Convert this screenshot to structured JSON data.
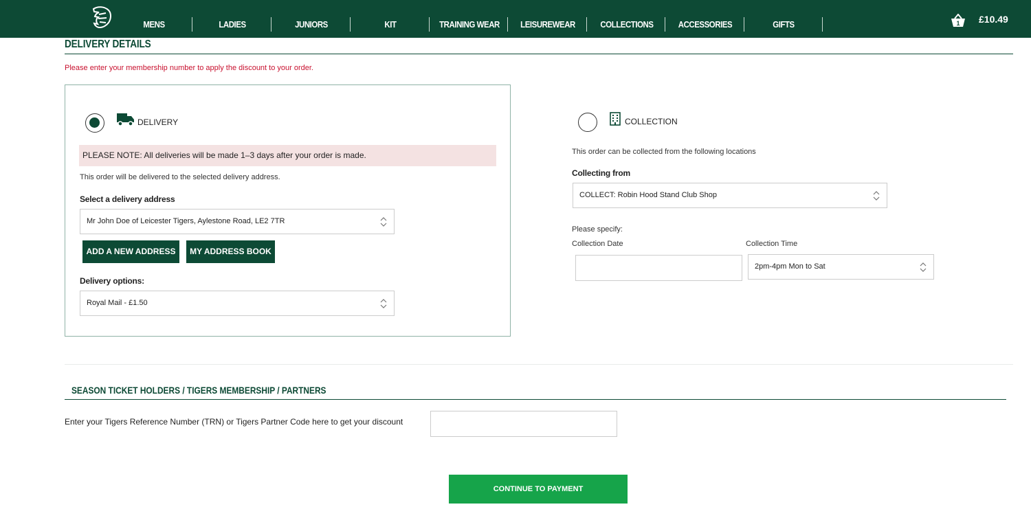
{
  "header": {
    "nav": [
      "MENS",
      "LADIES",
      "JUNIORS",
      "KIT",
      "TRAINING WEAR",
      "LEISUREWEAR",
      "COLLECTIONS",
      "ACCESSORIES",
      "GIFTS"
    ],
    "basket_count": "1",
    "basket_total": "£10.49"
  },
  "page": {
    "title": "DELIVERY DETAILS",
    "warning": "Please enter your membership number to apply the discount to your order."
  },
  "delivery": {
    "option_label": "DELIVERY",
    "note": "PLEASE NOTE: All deliveries will be made 1–3 days after your order is made.",
    "info": "This order will be delivered to the selected delivery address.",
    "address_label": "Select a delivery address",
    "address_value": "Mr John Doe of Leicester Tigers, Aylestone Road, LE2 7TR",
    "add_address_button": "ADD A NEW ADDRESS",
    "address_book_button": "MY ADDRESS BOOK",
    "options_label": "Delivery options:",
    "options_value": "Royal Mail - £1.50"
  },
  "collection": {
    "option_label": "COLLECTION",
    "info": "This order can be collected from the following locations",
    "from_label": "Collecting from",
    "from_value": "COLLECT: Robin Hood Stand Club Shop",
    "specify_label": "Please specify:",
    "date_label": "Collection Date",
    "date_value": "",
    "time_label": "Collection Time",
    "time_value": "2pm-4pm Mon to Sat"
  },
  "membership": {
    "title": "SEASON TICKET HOLDERS / TIGERS MEMBERSHIP / PARTNERS",
    "label": "Enter your Tigers Reference Number (TRN) or Tigers Partner Code here to get your discount",
    "value": ""
  },
  "continue_button": "CONTINUE TO PAYMENT",
  "colors": {
    "brand_green": "#0d4a35",
    "cta_green": "#16a44a",
    "warning_red": "#c8102e",
    "note_bg": "#f4e2e2"
  }
}
